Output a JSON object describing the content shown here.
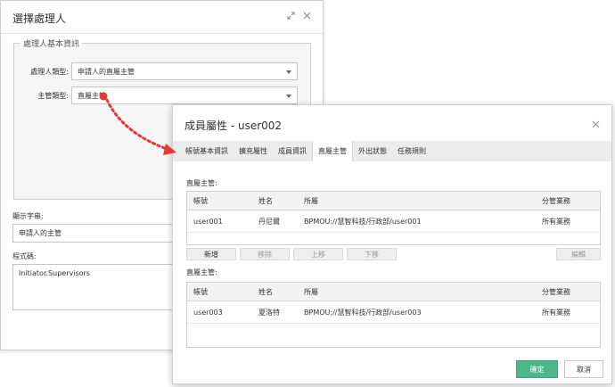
{
  "back_dialog": {
    "title": "選擇處理人",
    "fieldset_legend": "處理人基本資訊",
    "handler_type_label": "處理人類型:",
    "handler_type_value": "申請人的直屬主管",
    "supervisor_type_label": "主管類型:",
    "supervisor_type_value": "直屬主管",
    "display_label": "顯示字串:",
    "display_value": "申請人的主管",
    "code_label": "程式碼:",
    "code_value": "Initiator.Supervisors"
  },
  "front_dialog": {
    "title": "成員屬性 - user002",
    "tabs": [
      {
        "label": "帳號基本資訊"
      },
      {
        "label": "擴充屬性"
      },
      {
        "label": "成員資訊"
      },
      {
        "label": "直屬主管"
      },
      {
        "label": "外出狀態"
      },
      {
        "label": "任務規則"
      }
    ],
    "active_tab": "直屬主管",
    "section1": {
      "title": "直屬主管:",
      "columns": [
        "帳號",
        "姓名",
        "所屬",
        "分管業務"
      ],
      "rows": [
        {
          "account": "user001",
          "name": "丹尼爾",
          "dept": "BPMOU://慧智科技/行政部/user001",
          "duty": "所有業務"
        }
      ]
    },
    "buttons": {
      "add": "新增",
      "remove": "移除",
      "move_up": "上移",
      "move_down": "下移",
      "edit": "編輯"
    },
    "section2": {
      "title": "直屬主管:",
      "columns": [
        "帳號",
        "姓名",
        "所屬",
        "分管業務"
      ],
      "rows": [
        {
          "account": "user003",
          "name": "夏洛特",
          "dept": "BPMOU://慧智科技/行政部/user003",
          "duty": "所有業務"
        }
      ]
    },
    "ok_label": "確定",
    "cancel_label": "取消"
  },
  "icons": {
    "expand": "expand-icon",
    "close": "close-icon",
    "dropdown": "chevron-down-icon"
  },
  "colors": {
    "primary_button": "#4cb88a",
    "arrow": "#e53935",
    "tab_bar": "#ececec"
  }
}
